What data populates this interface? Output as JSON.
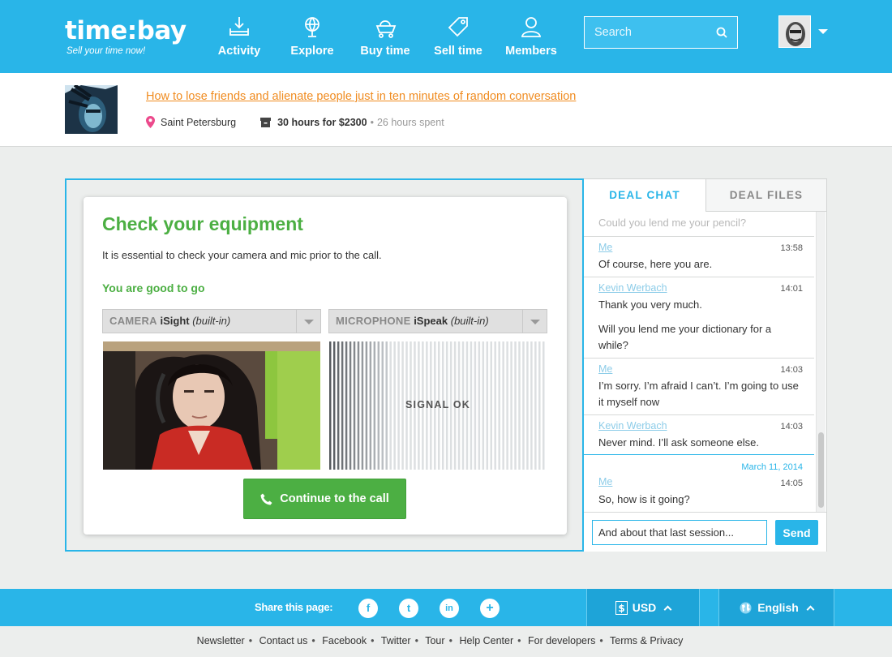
{
  "brand": {
    "name": "time:bay",
    "tagline": "Sell your time now!"
  },
  "nav": [
    {
      "label": "Activity",
      "icon": "inbox-download-icon"
    },
    {
      "label": "Explore",
      "icon": "globe-icon"
    },
    {
      "label": "Buy time",
      "icon": "cart-icon"
    },
    {
      "label": "Sell time",
      "icon": "tag-icon"
    },
    {
      "label": "Members",
      "icon": "user-icon"
    }
  ],
  "search": {
    "placeholder": "Search"
  },
  "deal": {
    "title": "How to lose friends and alienate people just in ten minutes of random conversation",
    "location": "Saint Petersburg",
    "hours": "30 hours for $2300",
    "spent": "26 hours spent"
  },
  "equipment": {
    "heading": "Check your equipment",
    "intro": "It is essential to check your camera and mic prior to the call.",
    "status": "You are good to go",
    "camera": {
      "key": "CAMERA",
      "device": "iSight",
      "note": "(built-in)"
    },
    "microphone": {
      "key": "MICROPHONE",
      "device": "iSpeak",
      "note": "(built-in)"
    },
    "signal": "SIGNAL OK",
    "signal_level": 0.28,
    "continue_label": "Continue to the call"
  },
  "chat": {
    "tabs": [
      "DEAL CHAT",
      "DEAL FILES"
    ],
    "partial_top": "Could you lend me your pencil?",
    "messages": [
      {
        "author": "Me",
        "time": "13:58",
        "text": "Of course, here you are."
      },
      {
        "author": "Kevin Werbach",
        "time": "14:01",
        "text": "Thank you very much.",
        "text2": "Will you lend me your dictionary for a while?"
      },
      {
        "author": "Me",
        "time": "14:03",
        "text": "I’m sorry. I’m afraid I can’t. I’m going to use it myself now"
      },
      {
        "author": "Kevin Werbach",
        "time": "14:03",
        "text": "Never mind. I’ll ask someone else."
      },
      {
        "date": "March 11, 2014",
        "author": "Me",
        "time": "14:05",
        "text": "So, how is it going?"
      }
    ],
    "input_value": "And about that last session...",
    "send_label": "Send"
  },
  "footer": {
    "share_label": "Share this page:",
    "social": [
      "f",
      "t",
      "in",
      "+"
    ],
    "currency": "USD",
    "language": "English",
    "links": [
      "Newsletter",
      "Contact us",
      "Facebook",
      "Twitter",
      "Tour",
      "Help Center",
      "For developers",
      "Terms & Privacy"
    ]
  },
  "colors": {
    "brand_blue": "#29b5e8",
    "success_green": "#4caf43",
    "link_orange": "#f08c21"
  }
}
